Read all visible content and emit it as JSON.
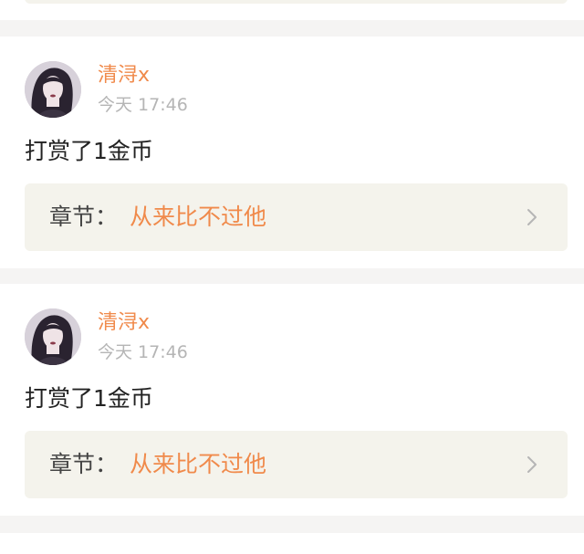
{
  "entries": [
    {
      "username": "清浔x",
      "time": "今天 17:46",
      "action": "打赏了1金币",
      "chapter_label": "章节：",
      "chapter_title": "从来比不过他"
    },
    {
      "username": "清浔x",
      "time": "今天 17:46",
      "action": "打赏了1金币",
      "chapter_label": "章节：",
      "chapter_title": "从来比不过他"
    }
  ],
  "colors": {
    "accent": "#f08a4b",
    "background": "#f5f4f3",
    "card": "#ffffff",
    "chapter_box": "#f4f3ec",
    "muted_text": "#b5b5b5"
  },
  "icons": {
    "chevron": "chevron-right-icon"
  }
}
